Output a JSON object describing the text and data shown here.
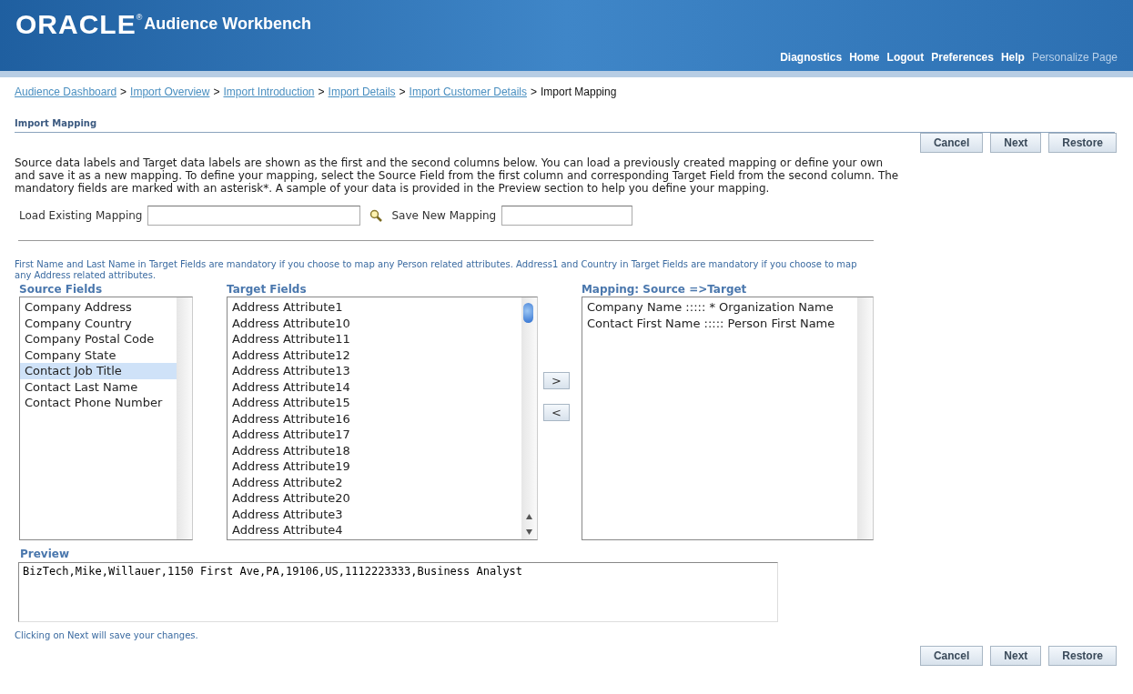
{
  "header": {
    "logo": "ORACLE",
    "logo_mark": "®",
    "title": "Audience Workbench",
    "links": [
      {
        "label": "Diagnostics",
        "disabled": false
      },
      {
        "label": "Home",
        "disabled": false
      },
      {
        "label": "Logout",
        "disabled": false
      },
      {
        "label": "Preferences",
        "disabled": false
      },
      {
        "label": "Help",
        "disabled": false
      },
      {
        "label": "Personalize Page",
        "disabled": true
      }
    ]
  },
  "breadcrumbs": [
    {
      "label": "Audience Dashboard",
      "current": false
    },
    {
      "label": "Import Overview",
      "current": false
    },
    {
      "label": "Import Introduction",
      "current": false
    },
    {
      "label": "Import Details",
      "current": false
    },
    {
      "label": "Import Customer Details",
      "current": false
    },
    {
      "label": "Import Mapping",
      "current": true
    }
  ],
  "breadcrumb_separator": ">",
  "section_title": "Import Mapping",
  "top_buttons": [
    "Cancel",
    "Next",
    "Restore"
  ],
  "description": "Source data labels and Target data labels are shown as the first and the second columns below. You can load a previously created mapping or define your own and save it as a new mapping. To define your mapping, select the Source Field from the first column and corresponding Target Field from the second column. The mandatory fields are marked with an asterisk*. A sample of your data is provided in the Preview section to help you define your mapping.",
  "load_mapping": {
    "label": "Load Existing Mapping"
  },
  "save_mapping": {
    "label": "Save New Mapping"
  },
  "note": "First Name and Last Name in Target Fields are mandatory if you choose to map any Person related attributes. Address1 and Country in Target Fields are mandatory if you choose to map any Address related attributes.",
  "source_fields": {
    "title": "Source Fields",
    "items": [
      {
        "label": "Company Address",
        "selected": false
      },
      {
        "label": "Company Country",
        "selected": false
      },
      {
        "label": "Company Postal Code",
        "selected": false
      },
      {
        "label": "Company State",
        "selected": false
      },
      {
        "label": "Contact Job Title",
        "selected": true
      },
      {
        "label": "Contact Last Name",
        "selected": false
      },
      {
        "label": "Contact Phone Number",
        "selected": false
      }
    ]
  },
  "target_fields": {
    "title": "Target Fields",
    "items": [
      {
        "label": "Address Attribute1",
        "selected": false
      },
      {
        "label": "Address Attribute10",
        "selected": false
      },
      {
        "label": "Address Attribute11",
        "selected": false
      },
      {
        "label": "Address Attribute12",
        "selected": false
      },
      {
        "label": "Address Attribute13",
        "selected": false
      },
      {
        "label": "Address Attribute14",
        "selected": false
      },
      {
        "label": "Address Attribute15",
        "selected": false
      },
      {
        "label": "Address Attribute16",
        "selected": false
      },
      {
        "label": "Address Attribute17",
        "selected": false
      },
      {
        "label": "Address Attribute18",
        "selected": false
      },
      {
        "label": "Address Attribute19",
        "selected": false
      },
      {
        "label": "Address Attribute2",
        "selected": false
      },
      {
        "label": "Address Attribute20",
        "selected": false
      },
      {
        "label": "Address Attribute3",
        "selected": false
      },
      {
        "label": "Address Attribute4",
        "selected": false
      }
    ]
  },
  "move_buttons": [
    ">",
    "<"
  ],
  "mapping": {
    "title": "Mapping: Source =>Target",
    "items": [
      {
        "label": "Company Name ::::: * Organization Name",
        "selected": false
      },
      {
        "label": "Contact First Name ::::: Person First Name",
        "selected": false
      }
    ]
  },
  "preview": {
    "title": "Preview",
    "value": "BizTech,Mike,Willauer,1150 First Ave,PA,19106,US,1112223333,Business Analyst"
  },
  "footer_note": "Clicking on Next will save your changes.",
  "bottom_buttons": [
    "Cancel",
    "Next",
    "Restore"
  ]
}
